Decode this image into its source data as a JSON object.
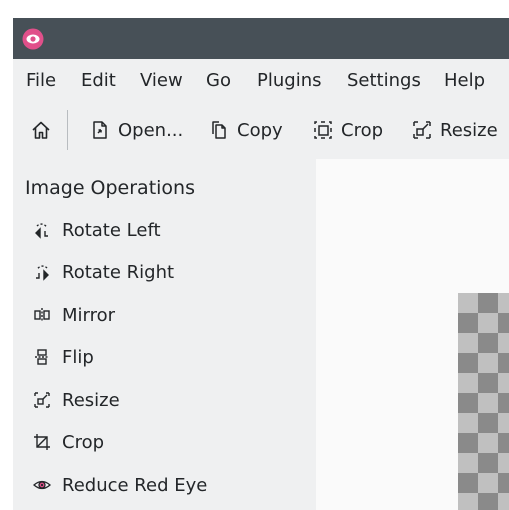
{
  "menu": {
    "file": "File",
    "edit": "Edit",
    "view": "View",
    "go": "Go",
    "plugins": "Plugins",
    "settings": "Settings",
    "help": "Help"
  },
  "toolbar": {
    "home_icon": "home-icon",
    "open": "Open...",
    "copy": "Copy",
    "crop": "Crop",
    "resize": "Resize"
  },
  "sidebar": {
    "title": "Image Operations",
    "items": [
      {
        "label": "Rotate Left",
        "icon": "rotate-left-icon"
      },
      {
        "label": "Rotate Right",
        "icon": "rotate-right-icon"
      },
      {
        "label": "Mirror",
        "icon": "mirror-icon"
      },
      {
        "label": "Flip",
        "icon": "flip-icon"
      },
      {
        "label": "Resize",
        "icon": "resize-icon"
      },
      {
        "label": "Crop",
        "icon": "crop-icon"
      },
      {
        "label": "Reduce Red Eye",
        "icon": "red-eye-icon"
      }
    ]
  },
  "colors": {
    "titlebar": "#475057",
    "window_bg": "#eff0f1",
    "app_icon": "#e0508a",
    "text": "#232629"
  }
}
